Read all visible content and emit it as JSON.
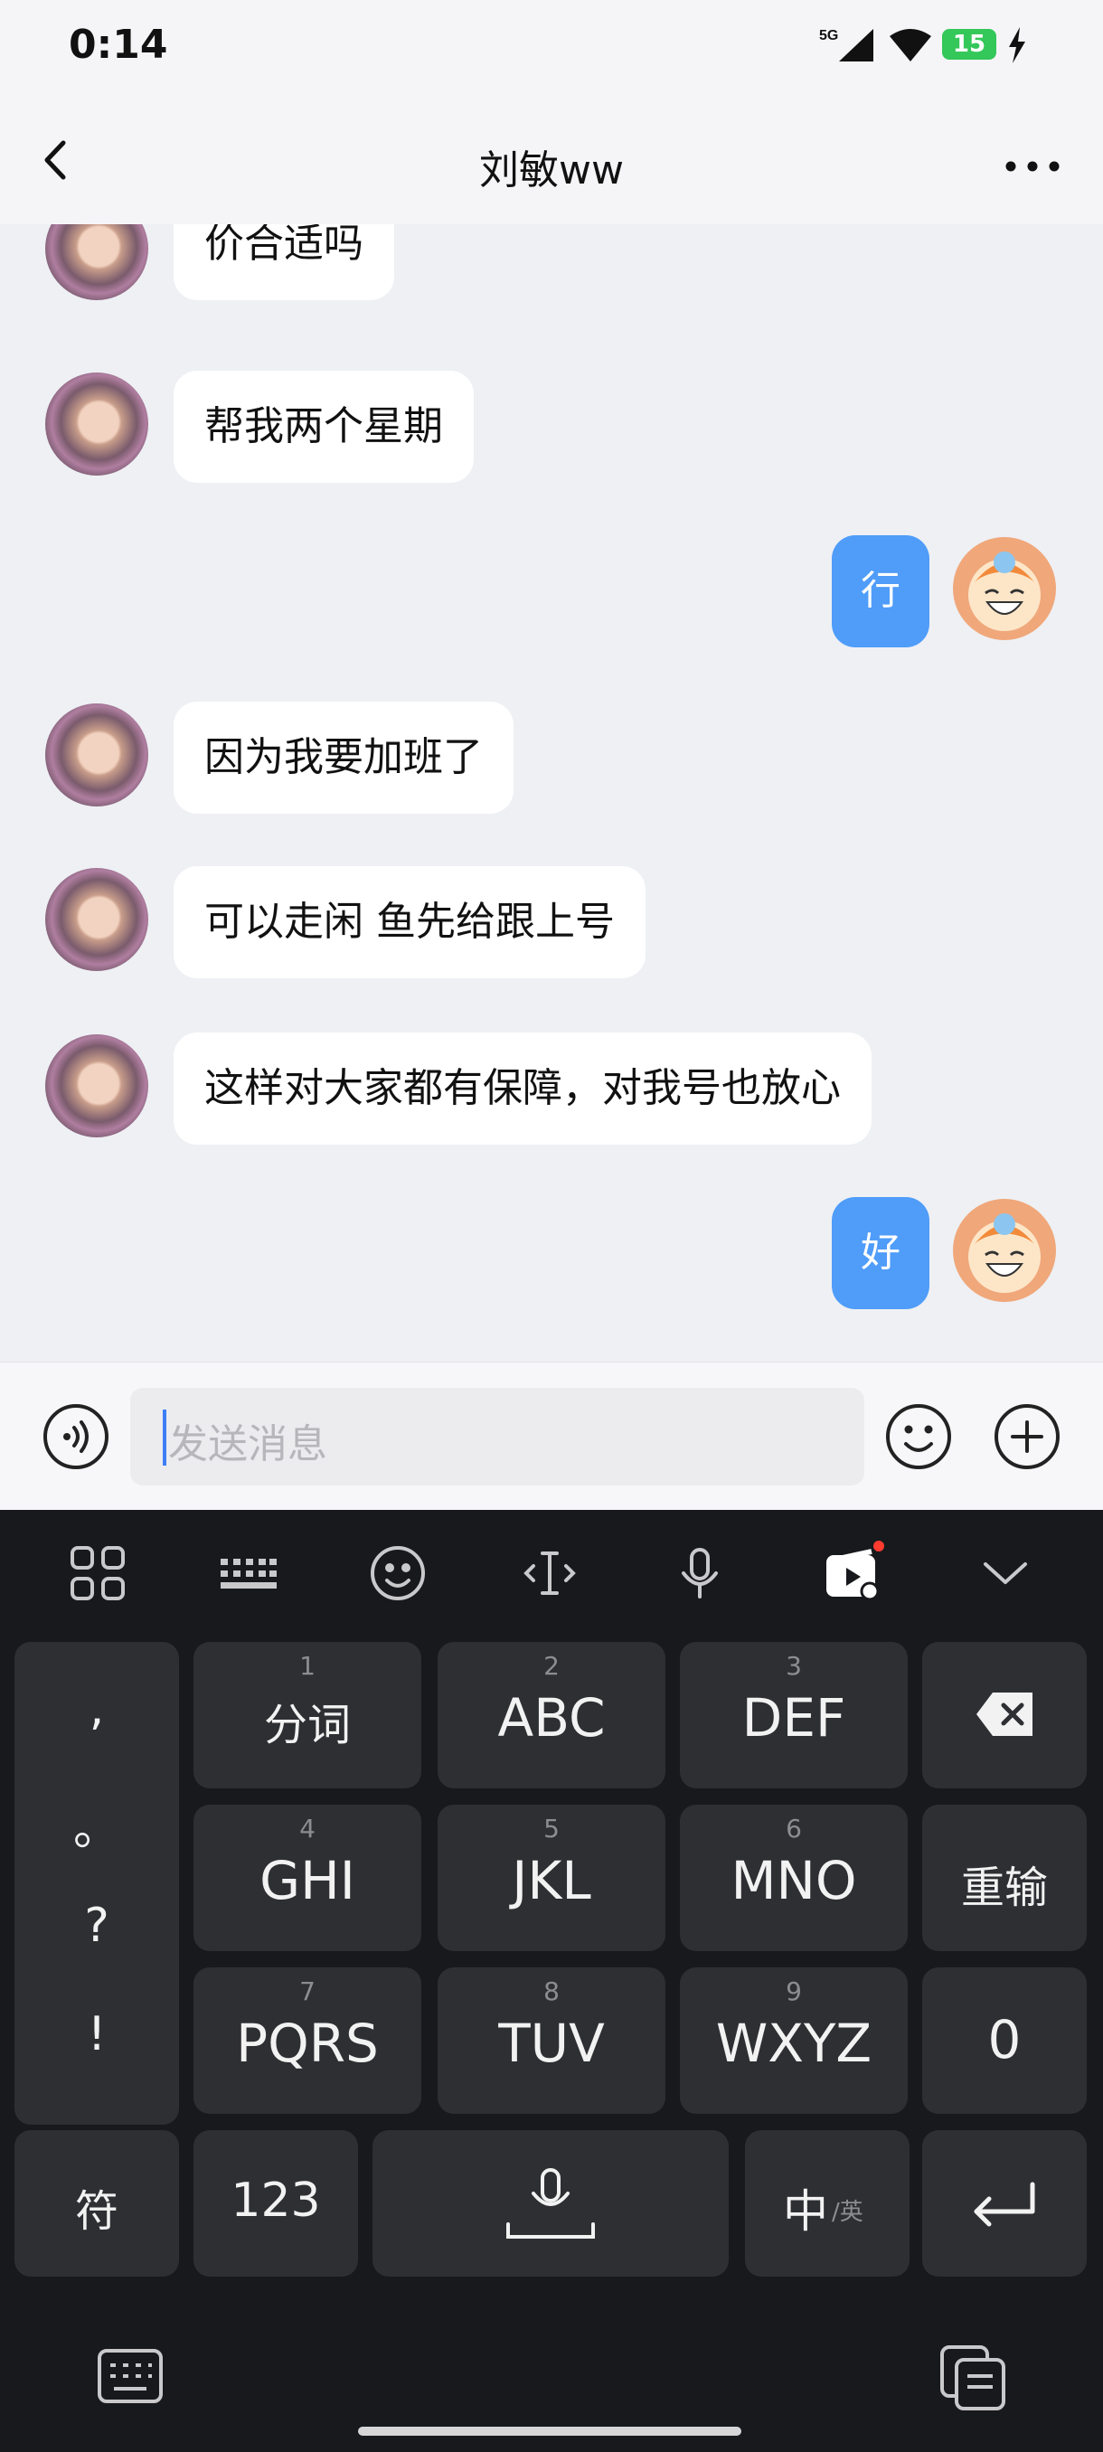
{
  "status_bar": {
    "time": "0:14",
    "network": "5G",
    "battery": "15"
  },
  "header": {
    "title": "刘敏ww"
  },
  "messages": [
    {
      "from": "other",
      "text": "价合适吗"
    },
    {
      "from": "other",
      "text": "帮我两个星期"
    },
    {
      "from": "me",
      "text": "行"
    },
    {
      "from": "other",
      "text": "因为我要加班了"
    },
    {
      "from": "other",
      "text": "可以走闲 鱼先给跟上号"
    },
    {
      "from": "other",
      "text": "这样对大家都有保障，对我号也放心"
    },
    {
      "from": "me",
      "text": "好"
    }
  ],
  "input": {
    "placeholder": "发送消息"
  },
  "keyboard": {
    "punct": [
      ",",
      "。",
      "?",
      "!"
    ],
    "keys": [
      {
        "num": "1",
        "label": "分词"
      },
      {
        "num": "2",
        "label": "ABC"
      },
      {
        "num": "3",
        "label": "DEF"
      },
      {
        "num": "4",
        "label": "GHI"
      },
      {
        "num": "5",
        "label": "JKL"
      },
      {
        "num": "6",
        "label": "MNO"
      },
      {
        "num": "7",
        "label": "PQRS"
      },
      {
        "num": "8",
        "label": "TUV"
      },
      {
        "num": "9",
        "label": "WXYZ"
      }
    ],
    "retype": "重输",
    "zero": "0",
    "symbols": "符",
    "numbers": "123",
    "lang_main": "中",
    "lang_alt": "/英"
  },
  "colors": {
    "accent": "#4f9cf9",
    "keyboard_bg": "#18191c",
    "key_bg": "#2e2f33"
  }
}
